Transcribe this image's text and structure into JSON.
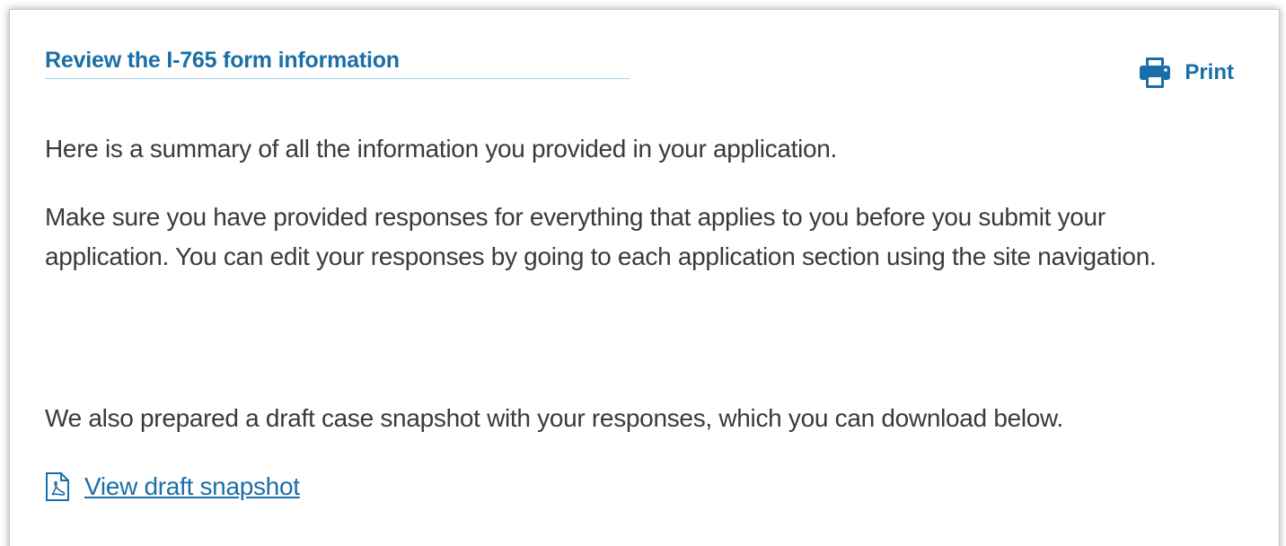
{
  "section": {
    "title": "Review the I-765 form information"
  },
  "print": {
    "label": "Print",
    "icon": "printer-icon"
  },
  "content": {
    "paragraph_1": "Here is a summary of all the information you provided in your application.",
    "paragraph_2": "Make sure you have provided responses for everything that applies to you before you submit your application. You can edit your responses by going to each application section using the site navigation.",
    "paragraph_3": "We also prepared a draft case snapshot with your responses, which you can download below."
  },
  "snapshot_link": {
    "label": "View draft snapshot",
    "icon": "pdf-file-icon"
  },
  "colors": {
    "accent": "#1a6fa8",
    "body_text": "#3a3a3a",
    "heading_rule": "#a9d6ec"
  }
}
